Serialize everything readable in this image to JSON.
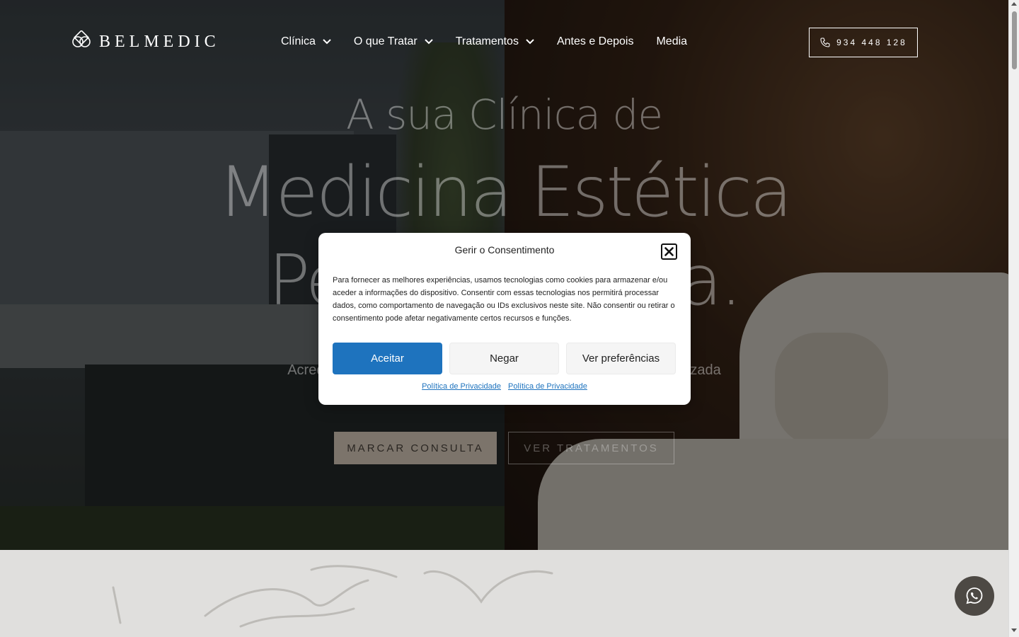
{
  "header": {
    "logo_text": "BELMEDIC",
    "nav": [
      {
        "label": "Clínica",
        "has_dropdown": true
      },
      {
        "label": "O que Tratar",
        "has_dropdown": true
      },
      {
        "label": "Tratamentos",
        "has_dropdown": true
      },
      {
        "label": "Antes e Depois",
        "has_dropdown": false
      },
      {
        "label": "Media",
        "has_dropdown": false
      }
    ],
    "phone": "934 448 128"
  },
  "hero": {
    "line1": "A sua Clínica de",
    "line2": "Medicina Estética",
    "line3": "Personalizada.",
    "subtitle": "Acreditamos numa medicina estética natural, segura e personalizada",
    "cta_primary": "MARCAR CONSULTA",
    "cta_secondary": "VER TRATAMENTOS"
  },
  "consent_modal": {
    "title": "Gerir o Consentimento",
    "body": "Para fornecer as melhores experiências, usamos tecnologias como cookies para armazenar e/ou aceder a informações do dispositivo. Consentir com essas tecnologias nos permitirá processar dados, como comportamento de navegação ou IDs exclusivos neste site. Não consentir ou retirar o consentimento pode afetar negativamente certos recursos e funções.",
    "accept_label": "Aceitar",
    "deny_label": "Negar",
    "preferences_label": "Ver preferências",
    "links": [
      "Política de Privacidade",
      "Política de Privacidade"
    ]
  },
  "colors": {
    "accept_button": "#1e73be",
    "link": "#1e73be",
    "cta_primary_bg": "#7c746b",
    "whatsapp_bg": "#4d4944"
  },
  "icons": {
    "close": "close-icon",
    "phone": "phone-icon",
    "whatsapp": "whatsapp-icon",
    "chevron": "chevron-down-icon"
  }
}
